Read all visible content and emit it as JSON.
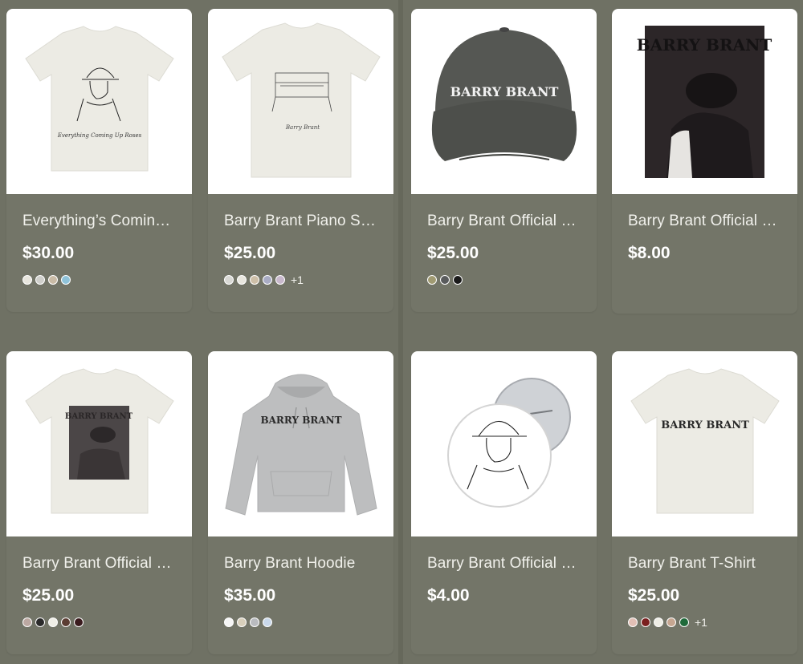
{
  "products": [
    {
      "title": "Everything’s Coming …",
      "price": "$30.00",
      "swatches": [
        "#e8e6de",
        "#cfcfcb",
        "#c9bba6",
        "#8fc3d9"
      ],
      "more": ""
    },
    {
      "title": "Barry Brant Piano Sk…",
      "price": "$25.00",
      "swatches": [
        "#d8d8d4",
        "#e8e6de",
        "#cdbfa8",
        "#a9acc4",
        "#c8b8cc"
      ],
      "more": "+1"
    },
    {
      "title": "Barry Brant Official …",
      "price": "$25.00",
      "swatches": [
        "#a09a72",
        "#595b5c",
        "#1a1a1a"
      ],
      "more": ""
    },
    {
      "title": "Barry Brant Official P…",
      "price": "$8.00",
      "swatches": [],
      "more": ""
    },
    {
      "title": "Barry Brant Official P…",
      "price": "$25.00",
      "swatches": [
        "#bca8a2",
        "#2a2a2a",
        "#efeee6",
        "#5b3d33",
        "#3a1b1e"
      ],
      "more": ""
    },
    {
      "title": "Barry Brant Hoodie",
      "price": "$35.00",
      "swatches": [
        "#f5f5f5",
        "#d8cfbb",
        "#b9bbbf",
        "#c9d8ea"
      ],
      "more": ""
    },
    {
      "title": "Barry Brant Official P…",
      "price": "$4.00",
      "swatches": [],
      "more": ""
    },
    {
      "title": "Barry Brant T-Shirt",
      "price": "$25.00",
      "swatches": [
        "#e2bfb5",
        "#7a1f1f",
        "#efeee6",
        "#c6a691",
        "#1f6a3a"
      ],
      "more": "+1"
    }
  ],
  "print_text": {
    "brand": "BARRY BRANT",
    "script_0": "Everything Coming Up Roses",
    "script_1": "Barry Brant"
  }
}
